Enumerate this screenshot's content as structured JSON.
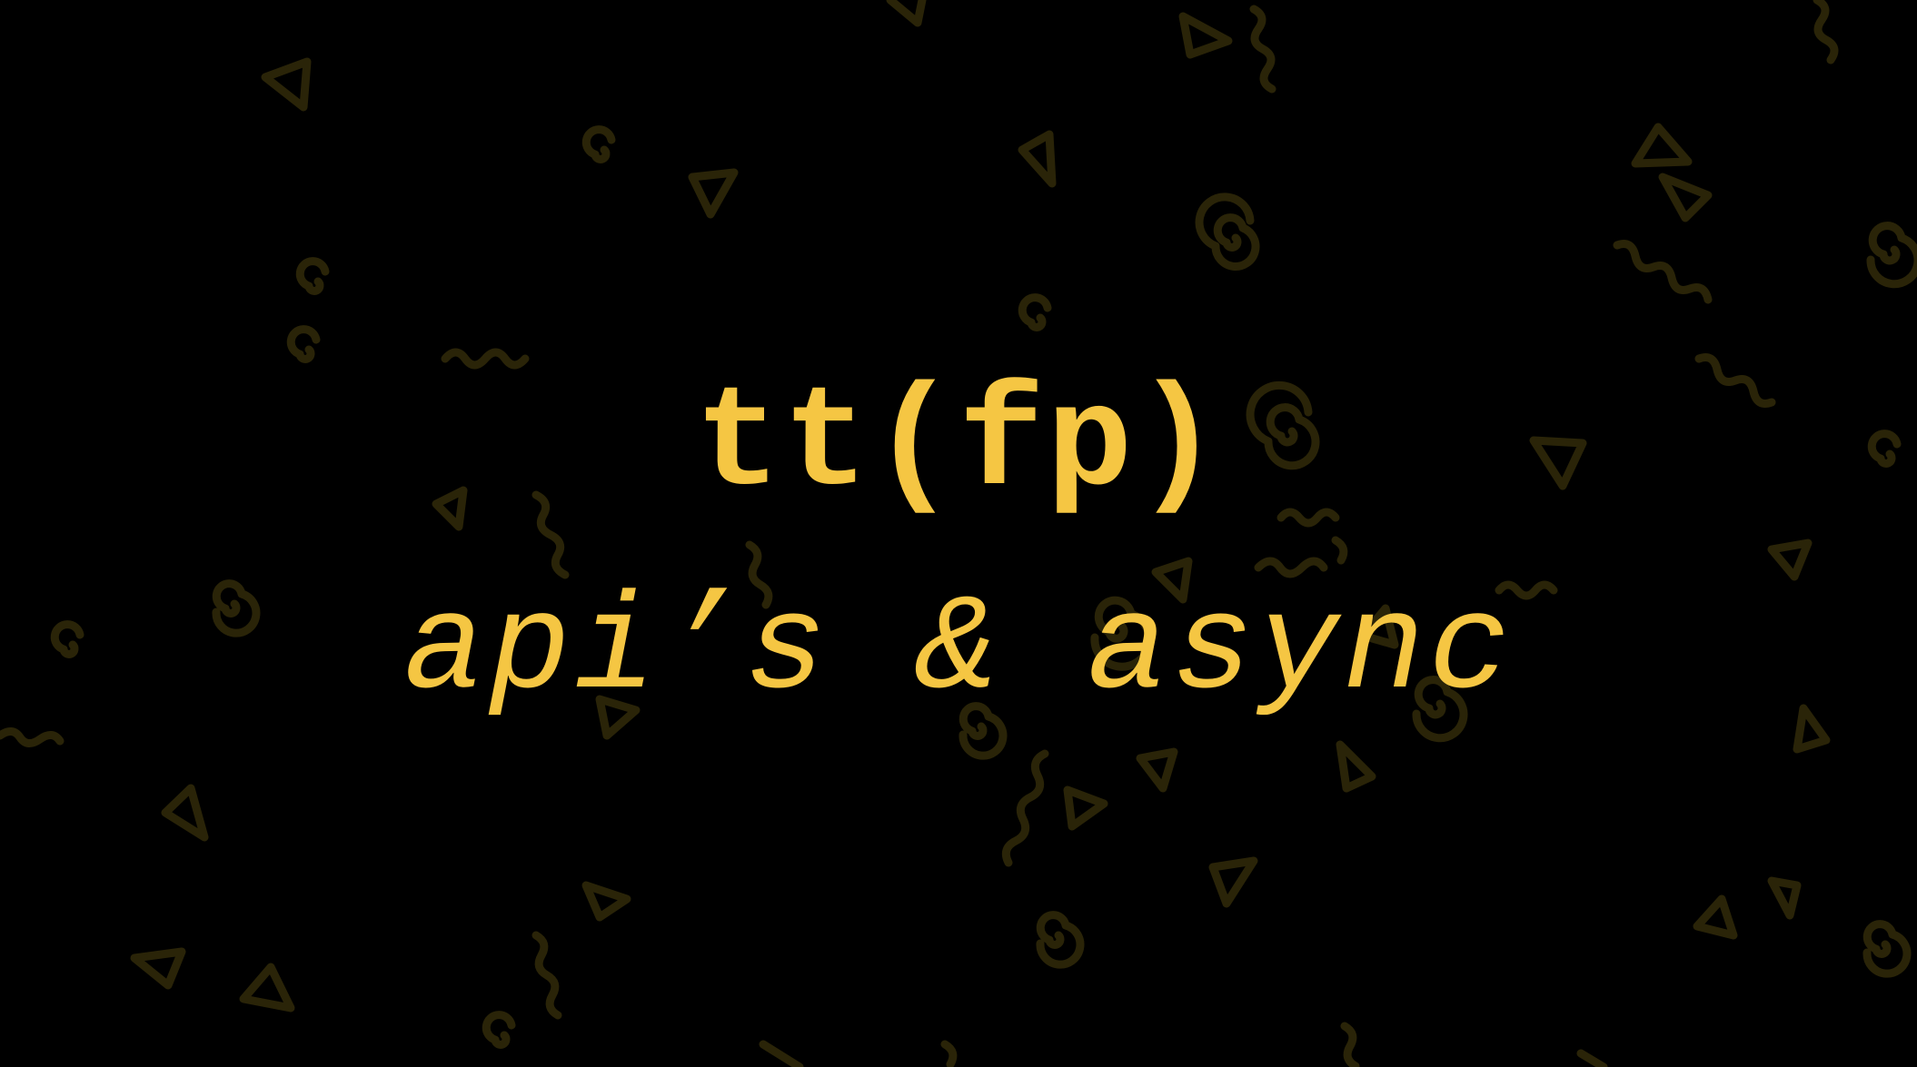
{
  "slide": {
    "title": "tt(fp)",
    "subtitle": "api’s & async"
  },
  "colors": {
    "background": "#000000",
    "text": "#f5c643",
    "pattern": "#2a2408"
  },
  "icons": [
    "triangle-icon",
    "spiral-icon",
    "squiggle-icon"
  ]
}
